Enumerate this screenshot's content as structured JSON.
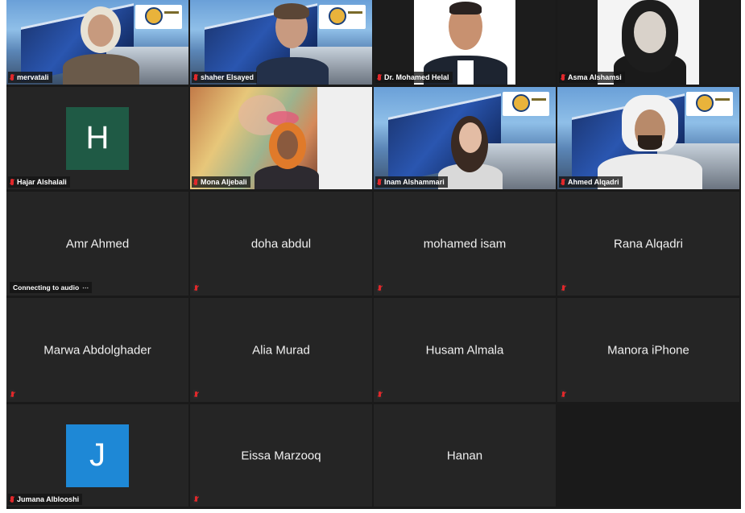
{
  "tiles": [
    {
      "name": "mervatali",
      "type": "video",
      "bg": "building"
    },
    {
      "name": "shaher Elsayed",
      "type": "video",
      "bg": "building"
    },
    {
      "name": "Dr. Mohamed Helal",
      "type": "video",
      "bg": "white"
    },
    {
      "name": "Asma Alshamsi",
      "type": "video",
      "bg": "white"
    },
    {
      "name": "Hajar Alshalali",
      "type": "avatar",
      "initial": "H",
      "avatar_color": "#1f5a45"
    },
    {
      "name": "Mona Aljebali",
      "type": "video",
      "bg": "art"
    },
    {
      "name": "Inam Alshammari",
      "type": "video",
      "bg": "building"
    },
    {
      "name": "Ahmed Alqadri",
      "type": "video",
      "bg": "building"
    },
    {
      "name": "Amr Ahmed",
      "type": "name",
      "status": "Connecting to audio"
    },
    {
      "name": "doha abdul",
      "type": "name"
    },
    {
      "name": "mohamed isam",
      "type": "name"
    },
    {
      "name": "Rana Alqadri",
      "type": "name"
    },
    {
      "name": "Marwa Abdolghader",
      "type": "name"
    },
    {
      "name": "Alia Murad",
      "type": "name"
    },
    {
      "name": "Husam Almala",
      "type": "name"
    },
    {
      "name": "Manora iPhone",
      "type": "name"
    },
    {
      "name": "Jumana Alblooshi",
      "type": "avatar",
      "initial": "J",
      "avatar_color": "#1e88d6"
    },
    {
      "name": "Eissa Marzooq",
      "type": "name"
    },
    {
      "name": "Hanan",
      "type": "name"
    }
  ],
  "colors": {
    "muted_mic": "#e0282b",
    "tile_bg": "#252525",
    "grid_bg": "#1a1a1a"
  },
  "icons": {
    "muted": "muted-mic-icon",
    "connecting": "audio-connecting-icon"
  }
}
